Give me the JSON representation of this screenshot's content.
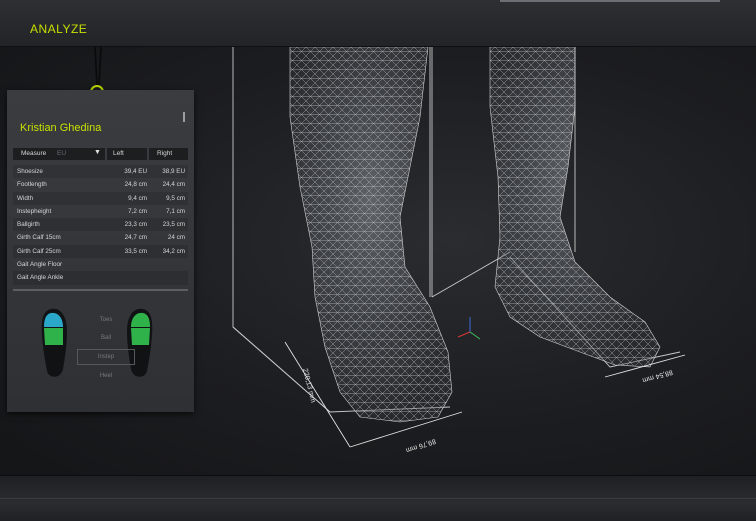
{
  "app": {
    "title": "ANALYZE"
  },
  "profile": {
    "name": "Kristian Ghedina"
  },
  "table": {
    "measure_label": "Measure",
    "unit": "EU",
    "left_label": "Left",
    "right_label": "Right",
    "rows": [
      {
        "name": "Shoesize",
        "left": "39,4 EU",
        "right": "38,9 EU"
      },
      {
        "name": "Footlength",
        "left": "24,8 cm",
        "right": "24,4 cm"
      },
      {
        "name": "Width",
        "left": "9,4 cm",
        "right": "9,5 cm"
      },
      {
        "name": "Instepheight",
        "left": "7,2 cm",
        "right": "7,1 cm"
      },
      {
        "name": "Ballgirth",
        "left": "23,3 cm",
        "right": "23,5 cm"
      },
      {
        "name": "Girth Calf 15cm",
        "left": "24,7 cm",
        "right": "24 cm"
      },
      {
        "name": "Girth Calf 25cm",
        "left": "33,5 cm",
        "right": "34,2 cm"
      },
      {
        "name": "Gait Angle Floor",
        "left": "",
        "right": ""
      },
      {
        "name": "Gait Angle Ankle",
        "left": "",
        "right": ""
      }
    ]
  },
  "zones": {
    "toes": "Toes",
    "ball": "Ball",
    "instep": "Instep",
    "heel": "Heel"
  },
  "dimensions": {
    "left_height": "220,13 mm",
    "left_width": "89,76 mm",
    "right_width": "88,54 mm"
  },
  "colors": {
    "accent": "#c8e000",
    "zone_toes": "#2aa7c9",
    "zone_ball": "#2fb24a"
  }
}
